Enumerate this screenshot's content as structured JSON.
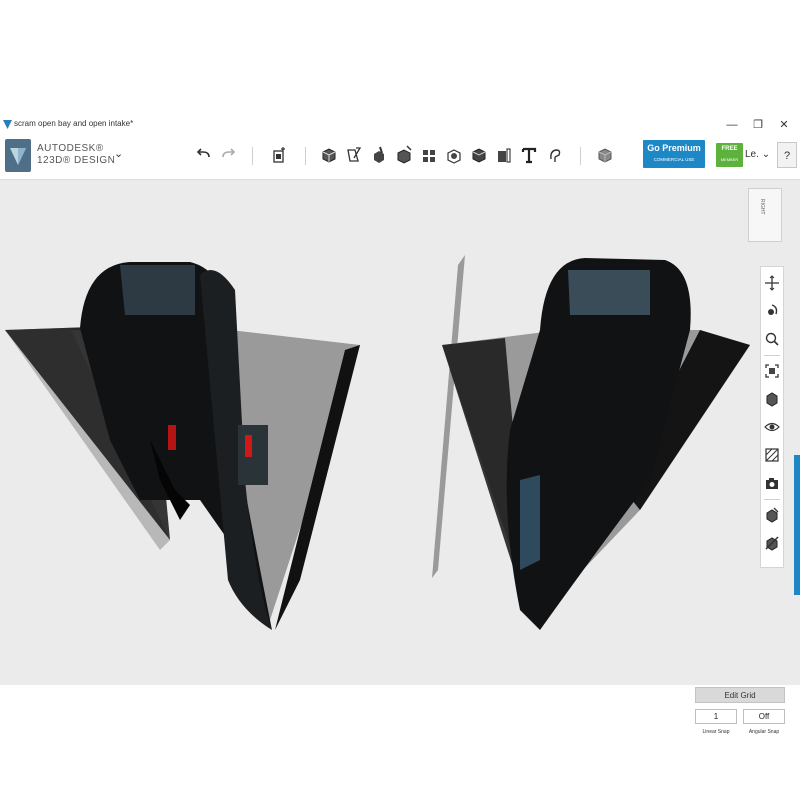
{
  "window": {
    "title": "scram open bay and open intake*",
    "controls": [
      "—",
      "❐",
      "✕"
    ]
  },
  "brand": {
    "line1": "AUTODESK®",
    "line2": "123D® DESIGN",
    "menu_icon": "chevron-down-icon"
  },
  "toolbar": {
    "tools": [
      {
        "name": "undo-icon"
      },
      {
        "name": "redo-icon"
      },
      {
        "name": "transform-icon"
      },
      {
        "name": "primitives-icon"
      },
      {
        "name": "sketch-icon"
      },
      {
        "name": "construct-icon"
      },
      {
        "name": "modify-icon"
      },
      {
        "name": "pattern-icon"
      },
      {
        "name": "grouping-icon"
      },
      {
        "name": "combine-icon"
      },
      {
        "name": "measure-icon"
      },
      {
        "name": "text-icon"
      },
      {
        "name": "snap-icon"
      },
      {
        "name": "material-icon"
      }
    ],
    "premium": {
      "label": "Go Premium",
      "sublabel": "COMMERCIAL USE"
    },
    "free_badge": {
      "label": "FREE",
      "sublabel": "MEMBER"
    },
    "user": "Le.",
    "help": "?"
  },
  "viewcube": {
    "face": "RIGHT"
  },
  "navigation": {
    "tools": [
      "pan-icon",
      "orbit-icon",
      "zoom-icon",
      "fit-icon",
      "perspective-icon",
      "visibility-icon",
      "material-display-icon",
      "camera-icon",
      "show-hide-icon",
      "hide-icon"
    ]
  },
  "grid": {
    "edit_label": "Edit Grid",
    "linear_snap_value": "1",
    "angular_snap_value": "Off",
    "linear_snap_label": "Linear Snap",
    "angular_snap_label": "Angular Snap"
  },
  "colors": {
    "accent": "#1e88c7",
    "free": "#5cb23c",
    "viewport": "#ebebeb",
    "model_body": "#101214",
    "model_wing": "#9a9a9a"
  }
}
